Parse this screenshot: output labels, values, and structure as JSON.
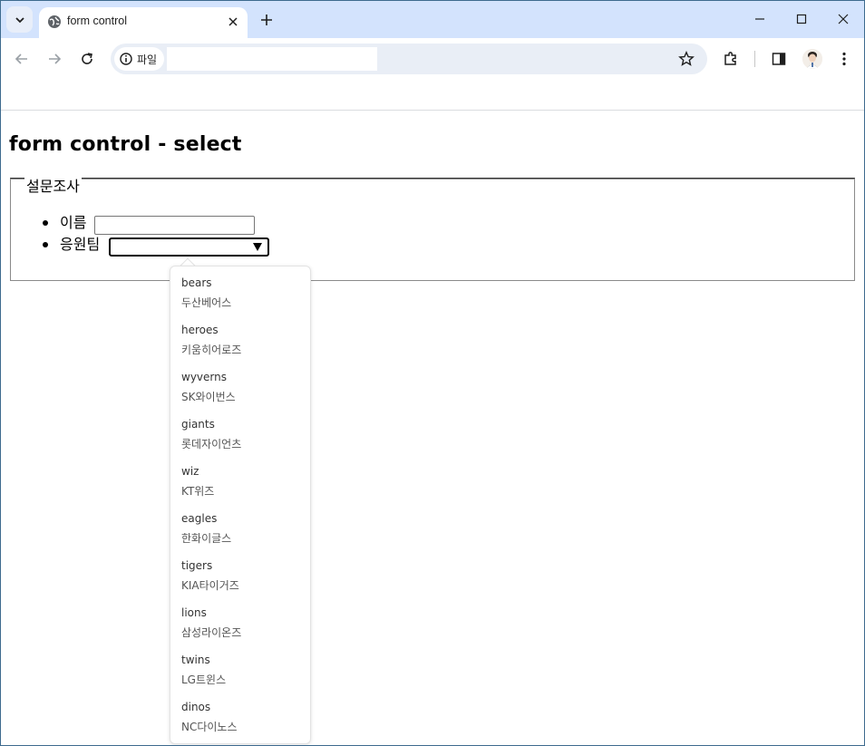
{
  "browser": {
    "tab_title": "form control",
    "site_chip_label": "파일",
    "url": ""
  },
  "page": {
    "title": "form control - select",
    "fieldset_legend": "설문조사",
    "name_label": "이름",
    "team_label": "응원팀",
    "name_value": "",
    "team_value": ""
  },
  "dropdown": {
    "options": [
      {
        "value": "bears",
        "label": "두산베어스"
      },
      {
        "value": "heroes",
        "label": "키움히어로즈"
      },
      {
        "value": "wyverns",
        "label": "SK와이번스"
      },
      {
        "value": "giants",
        "label": "롯데자이언츠"
      },
      {
        "value": "wiz",
        "label": "KT위즈"
      },
      {
        "value": "eagles",
        "label": "한화이글스"
      },
      {
        "value": "tigers",
        "label": "KIA타이거즈"
      },
      {
        "value": "lions",
        "label": "삼성라이온즈"
      },
      {
        "value": "twins",
        "label": "LG트윈스"
      },
      {
        "value": "dinos",
        "label": "NC다이노스"
      }
    ]
  },
  "icons": {
    "tab_search": "chevron-down-icon",
    "favicon": "globe-icon",
    "tab_close": "close-icon",
    "new_tab": "plus-icon",
    "back": "back-arrow-icon",
    "forward": "forward-arrow-icon",
    "reload": "reload-icon",
    "site_info": "info-icon",
    "bookmark": "star-icon",
    "extensions": "puzzle-icon",
    "side_panel": "side-panel-icon",
    "menu": "kebab-menu-icon"
  },
  "colors": {
    "tabstrip": "#d3e3fd",
    "omnibox": "#e9eef6"
  }
}
